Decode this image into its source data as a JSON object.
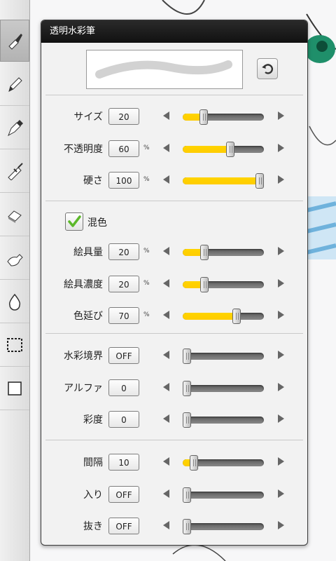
{
  "panel": {
    "title": "透明水彩筆",
    "reset_icon": "undo-arrow-icon"
  },
  "toolbar": {
    "tools": [
      {
        "name": "brush-tool",
        "icon": "brush-icon",
        "selected": true
      },
      {
        "name": "pencil-tool",
        "icon": "pencil-icon",
        "selected": false
      },
      {
        "name": "pen-tool",
        "icon": "pen-nib-icon",
        "selected": false
      },
      {
        "name": "airbrush-tool",
        "icon": "airbrush-icon",
        "selected": false
      },
      {
        "name": "eraser-tool",
        "icon": "eraser-icon",
        "selected": false
      },
      {
        "name": "blur-tool",
        "icon": "smudge-icon",
        "selected": false
      },
      {
        "name": "fill-tool",
        "icon": "drop-icon",
        "selected": false
      },
      {
        "name": "selection-tool",
        "icon": "marquee-icon",
        "selected": false
      },
      {
        "name": "color-tool",
        "icon": "color-square-icon",
        "selected": false
      }
    ]
  },
  "brush_settings": [
    {
      "label": "サイズ",
      "value": "20",
      "unit": "",
      "level": 0.23
    },
    {
      "label": "不透明度",
      "value": "60",
      "unit": "%",
      "level": 0.6
    },
    {
      "label": "硬さ",
      "value": "100",
      "unit": "%",
      "level": 1.0
    }
  ],
  "mix": {
    "label": "混色",
    "checked": true
  },
  "mix_settings": [
    {
      "label": "絵具量",
      "value": "20",
      "unit": "%",
      "level": 0.24
    },
    {
      "label": "絵具濃度",
      "value": "20",
      "unit": "%",
      "level": 0.24
    },
    {
      "label": "色延び",
      "value": "70",
      "unit": "%",
      "level": 0.68
    }
  ],
  "edge_settings": [
    {
      "label": "水彩境界",
      "value": "OFF",
      "unit": "",
      "level": 0.0
    },
    {
      "label": "アルファ",
      "value": "0",
      "unit": "",
      "level": 0.0
    },
    {
      "label": "彩度",
      "value": "0",
      "unit": "",
      "level": 0.0
    }
  ],
  "stroke_settings": [
    {
      "label": "間隔",
      "value": "10",
      "unit": "",
      "level": 0.1
    },
    {
      "label": "入り",
      "value": "OFF",
      "unit": "",
      "level": 0.0
    },
    {
      "label": "抜き",
      "value": "OFF",
      "unit": "",
      "level": 0.0
    }
  ],
  "colors": {
    "slider_fill": "#ffcc00",
    "checkmark": "#5cb82a",
    "title_bar": "#1a1a1a"
  }
}
